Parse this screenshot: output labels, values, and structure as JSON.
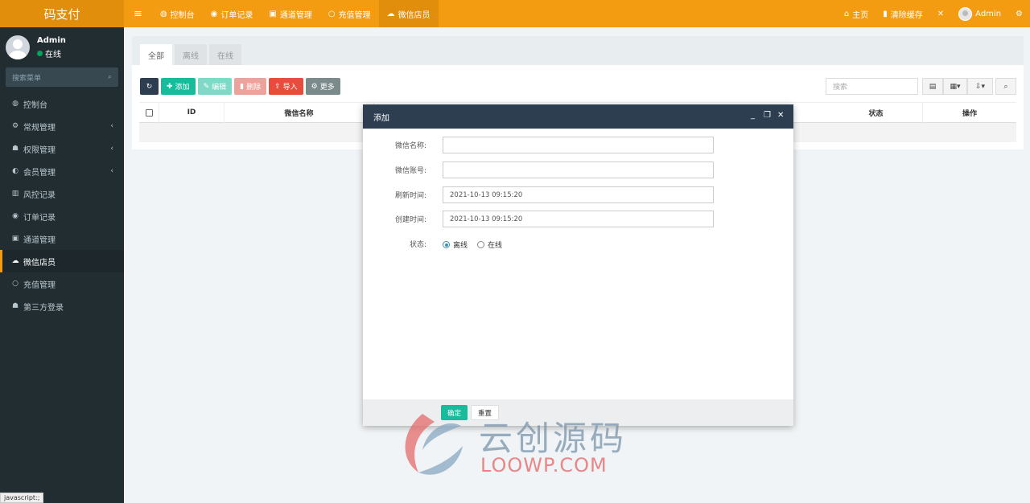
{
  "app": {
    "logo": "码支付"
  },
  "topnav": {
    "items": [
      {
        "icon": "dashboard-icon",
        "label": "控制台"
      },
      {
        "icon": "order-icon",
        "label": "订单记录"
      },
      {
        "icon": "channel-icon",
        "label": "通道管理"
      },
      {
        "icon": "circle-icon",
        "label": "充值管理"
      },
      {
        "icon": "wechat-icon",
        "label": "微信店员"
      }
    ],
    "right": {
      "home": "主页",
      "clear_cache": "清除缓存",
      "user": "Admin"
    }
  },
  "sidebar": {
    "user": {
      "name": "Admin",
      "status": "在线"
    },
    "search_placeholder": "搜索菜单",
    "items": [
      {
        "icon": "dashboard-icon",
        "label": "控制台",
        "expandable": false
      },
      {
        "icon": "cogs-icon",
        "label": "常规管理",
        "expandable": true
      },
      {
        "icon": "group-icon",
        "label": "权限管理",
        "expandable": true
      },
      {
        "icon": "user-circle-icon",
        "label": "会员管理",
        "expandable": true
      },
      {
        "icon": "map-icon",
        "label": "风控记录",
        "expandable": false
      },
      {
        "icon": "order-icon",
        "label": "订单记录",
        "expandable": false
      },
      {
        "icon": "channel-icon",
        "label": "通道管理",
        "expandable": false
      },
      {
        "icon": "wechat-icon",
        "label": "微信店员",
        "expandable": false,
        "active": true
      },
      {
        "icon": "circle-icon",
        "label": "充值管理",
        "expandable": false
      },
      {
        "icon": "group-icon",
        "label": "第三方登录",
        "expandable": false
      }
    ]
  },
  "content": {
    "tabs": [
      "全部",
      "离线",
      "在线"
    ],
    "toolbar": {
      "add": "添加",
      "edit": "编辑",
      "delete": "删除",
      "import": "导入",
      "more": "更多"
    },
    "search_placeholder": "搜索",
    "columns": [
      "ID",
      "微信名称",
      "状态",
      "操作"
    ]
  },
  "modal": {
    "title": "添加",
    "fields": [
      {
        "label": "微信名称:",
        "value": ""
      },
      {
        "label": "微信账号:",
        "value": ""
      },
      {
        "label": "刷新时间:",
        "value": "2021-10-13 09:15:20"
      },
      {
        "label": "创建时间:",
        "value": "2021-10-13 09:15:20"
      }
    ],
    "status_label": "状态:",
    "status_options": [
      {
        "label": "离线",
        "checked": true
      },
      {
        "label": "在线",
        "checked": false
      }
    ],
    "ok": "确定",
    "reset": "重置"
  },
  "watermark": {
    "cn": "云创源码",
    "en": "LOOWP.COM"
  },
  "statusbar": "javascript:;"
}
